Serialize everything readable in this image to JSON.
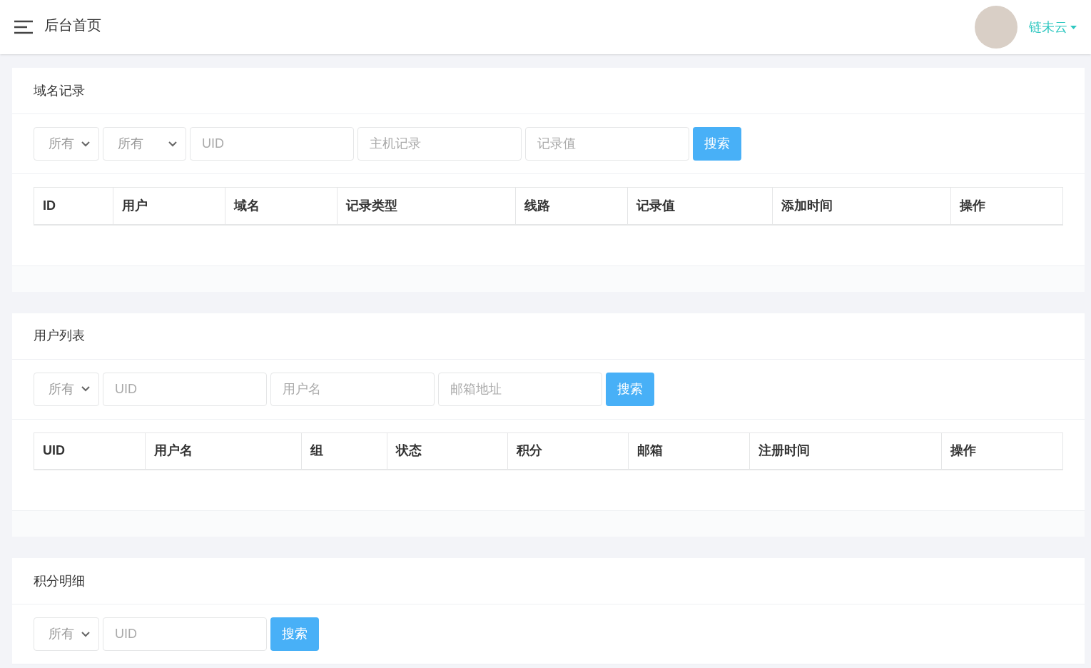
{
  "header": {
    "title": "后台首页",
    "user": "链未云"
  },
  "panels": [
    {
      "title": "域名记录",
      "filters": [
        {
          "kind": "select",
          "value": "所有"
        },
        {
          "kind": "select",
          "value": "所有"
        },
        {
          "kind": "input",
          "placeholder": "UID"
        },
        {
          "kind": "input",
          "placeholder": "主机记录"
        },
        {
          "kind": "input",
          "placeholder": "记录值"
        }
      ],
      "button": "搜索",
      "columns": [
        "ID",
        "用户",
        "域名",
        "记录类型",
        "线路",
        "记录值",
        "添加时间",
        "操作"
      ]
    },
    {
      "title": "用户列表",
      "filters": [
        {
          "kind": "select",
          "value": "所有"
        },
        {
          "kind": "input",
          "placeholder": "UID"
        },
        {
          "kind": "input",
          "placeholder": "用户名"
        },
        {
          "kind": "input",
          "placeholder": "邮箱地址"
        }
      ],
      "button": "搜索",
      "columns": [
        "UID",
        "用户名",
        "组",
        "状态",
        "积分",
        "邮箱",
        "注册时间",
        "操作"
      ]
    },
    {
      "title": "积分明细",
      "filters": [
        {
          "kind": "select",
          "value": "所有"
        },
        {
          "kind": "input",
          "placeholder": "UID"
        }
      ],
      "button": "搜索"
    }
  ]
}
